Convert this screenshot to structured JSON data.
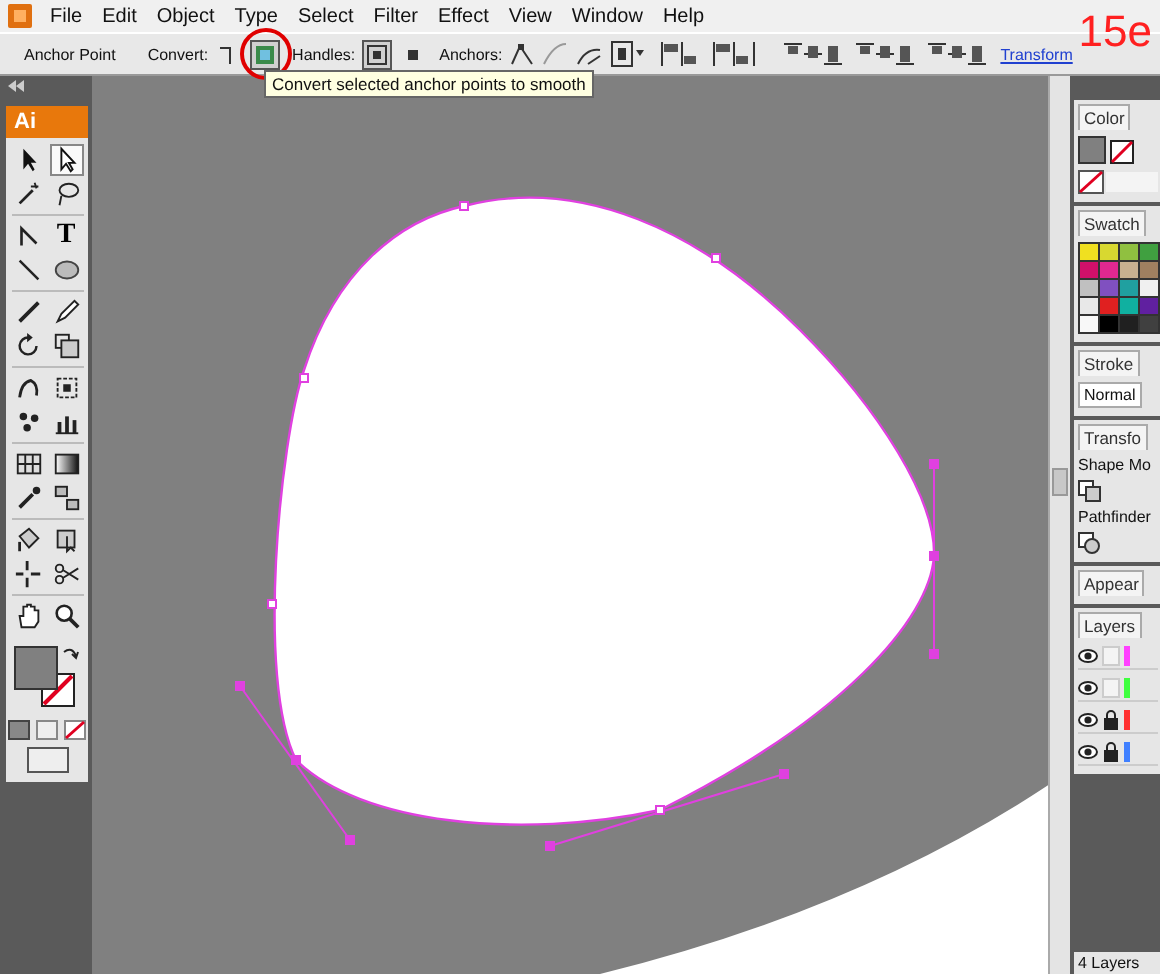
{
  "menu_bar": {
    "items": [
      "File",
      "Edit",
      "Object",
      "Type",
      "Select",
      "Filter",
      "Effect",
      "View",
      "Window",
      "Help"
    ]
  },
  "control_bar": {
    "tool_name": "Anchor Point",
    "convert_label": "Convert:",
    "convert_buttons": [
      {
        "kind": "corner",
        "selected": false
      },
      {
        "kind": "smooth",
        "selected": true
      }
    ],
    "handles_label": "Handles:",
    "handle_buttons": [
      {
        "kind": "show",
        "selected": true
      },
      {
        "kind": "hide",
        "selected": false
      }
    ],
    "anchors_label": "Anchors:",
    "transform_link": "Transform"
  },
  "tooltip": "Convert selected anchor points to smooth",
  "step_label": "15e",
  "toolbox": {
    "logo": "Ai",
    "tools": [
      {
        "kind": "arrow",
        "selected": false
      },
      {
        "kind": "hollow-arrow",
        "selected": true
      },
      {
        "kind": "wand",
        "selected": false
      },
      {
        "kind": "lasso",
        "selected": false
      },
      {
        "kind": "pen",
        "selected": false
      },
      {
        "kind": "type",
        "glyph": "T",
        "selected": false
      },
      {
        "kind": "line",
        "selected": false
      },
      {
        "kind": "ellipse",
        "selected": false
      },
      {
        "kind": "brush",
        "selected": false
      },
      {
        "kind": "pencil",
        "selected": false
      },
      {
        "kind": "rotate",
        "selected": false
      },
      {
        "kind": "scale",
        "selected": false
      },
      {
        "kind": "warp",
        "selected": false
      },
      {
        "kind": "transform",
        "selected": false
      },
      {
        "kind": "spray",
        "selected": false
      },
      {
        "kind": "graph",
        "selected": false
      },
      {
        "kind": "mesh",
        "selected": false
      },
      {
        "kind": "gradient",
        "selected": false
      },
      {
        "kind": "eyedropper",
        "selected": false
      },
      {
        "kind": "blend",
        "selected": false
      },
      {
        "kind": "paint",
        "selected": false
      },
      {
        "kind": "paint-select",
        "selected": false
      },
      {
        "kind": "slice",
        "selected": false
      },
      {
        "kind": "scissors",
        "selected": false
      },
      {
        "kind": "hand",
        "selected": false
      },
      {
        "kind": "zoom",
        "selected": false
      }
    ]
  },
  "panels": {
    "color": {
      "tab": "Color"
    },
    "swatches": {
      "tab": "Swatch",
      "colors": [
        {
          "color": "#f0e020"
        },
        {
          "color": "#d8d830"
        },
        {
          "color": "#90c040"
        },
        {
          "color": "#40a040"
        },
        {
          "color": "#d0106a"
        },
        {
          "color": "#e02890"
        },
        {
          "color": "#c8b090"
        },
        {
          "color": "#a08060"
        },
        {
          "color": "#c0c0c0"
        },
        {
          "color": "#8050c0"
        },
        {
          "color": "#20a0a0"
        },
        {
          "color": "#f0f0f0"
        },
        {
          "color": "#e8e8e8"
        },
        {
          "color": "#e02020"
        },
        {
          "color": "#10b0a0"
        },
        {
          "color": "#6020a0"
        },
        {
          "color": "#f8f8f8"
        },
        {
          "color": "#000000"
        },
        {
          "color": "#202020"
        },
        {
          "color": "#404040"
        }
      ]
    },
    "stroke": {
      "tab": "Stroke",
      "mode": "Normal"
    },
    "transform": {
      "tab": "Transfo",
      "shape_label": "Shape Mo",
      "pathfinder_label": "Pathfinder"
    },
    "appearance": {
      "tab": "Appear"
    },
    "layers": {
      "tab": "Layers",
      "rows": [
        {
          "visible": true,
          "locked": false,
          "color": "#ff40ff"
        },
        {
          "visible": true,
          "locked": false,
          "color": "#40ff40"
        },
        {
          "visible": true,
          "locked": true,
          "color": "#ff3030"
        },
        {
          "visible": true,
          "locked": true,
          "color": "#4080ff"
        }
      ],
      "count": "4 Layers"
    }
  }
}
